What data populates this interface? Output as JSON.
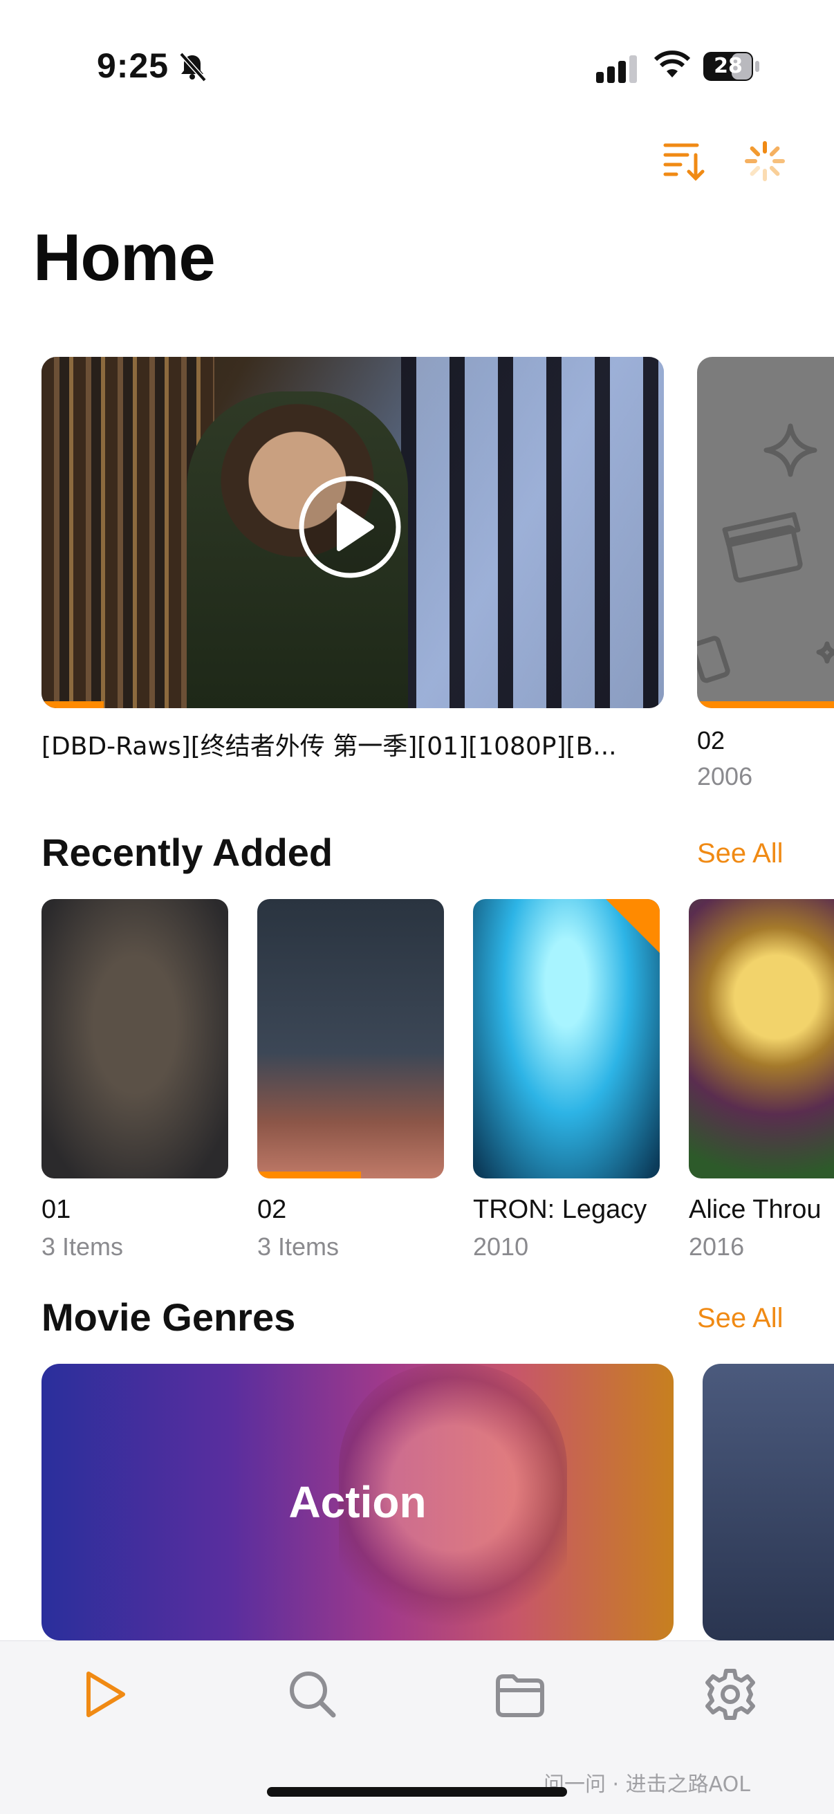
{
  "status_bar": {
    "time": "9:25",
    "battery": "28"
  },
  "page": {
    "title": "Home"
  },
  "continue_watching": [
    {
      "title": "[DBD-Raws][终结者外传 第一季][01][1080P][B...",
      "progress": 0.1
    },
    {
      "title": "02",
      "year": "2006",
      "progress": 1.0
    }
  ],
  "recently_added": {
    "heading": "Recently Added",
    "see_all": "See All",
    "items": [
      {
        "title": "01",
        "sub": "3 Items"
      },
      {
        "title": "02",
        "sub": "3 Items",
        "progress": 0.55
      },
      {
        "title": "TRON: Legacy",
        "sub": "2010"
      },
      {
        "title": "Alice Throu",
        "sub": "2016"
      }
    ]
  },
  "movie_genres": {
    "heading": "Movie Genres",
    "see_all": "See All",
    "items": [
      {
        "label": "Action"
      }
    ]
  },
  "tab_bar": {
    "items": [
      {
        "icon": "play-icon",
        "active": true
      },
      {
        "icon": "search-icon",
        "active": false
      },
      {
        "icon": "folder-icon",
        "active": false
      },
      {
        "icon": "gear-icon",
        "active": false
      }
    ]
  },
  "watermark": "问一问 · 进击之路AOL",
  "colors": {
    "accent": "#f08a14",
    "progress": "#ff8a00"
  }
}
